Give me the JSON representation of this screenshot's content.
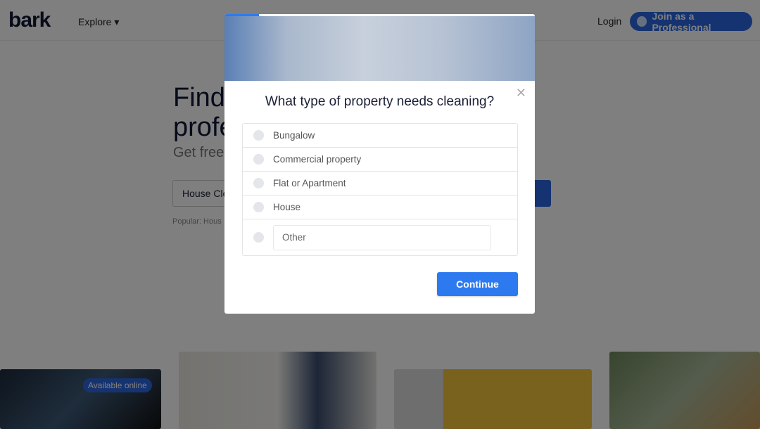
{
  "header": {
    "logo": "bark",
    "explore": "Explore ▾",
    "login": "Login",
    "join": "Join as a Professional"
  },
  "hero": {
    "title_line1": "Find",
    "title_line2": "profe",
    "subtitle": "Get free",
    "search_value": "House Cle",
    "popular": "Popular: Hous"
  },
  "cards": {
    "badge": "Available online"
  },
  "modal": {
    "progress_percent": 11,
    "title": "What type of property needs cleaning?",
    "options": [
      "Bungalow",
      "Commercial property",
      "Flat or Apartment",
      "House"
    ],
    "other_placeholder": "Other",
    "continue": "Continue"
  },
  "colors": {
    "accent": "#2d7af0",
    "brand": "#2a66e0"
  }
}
